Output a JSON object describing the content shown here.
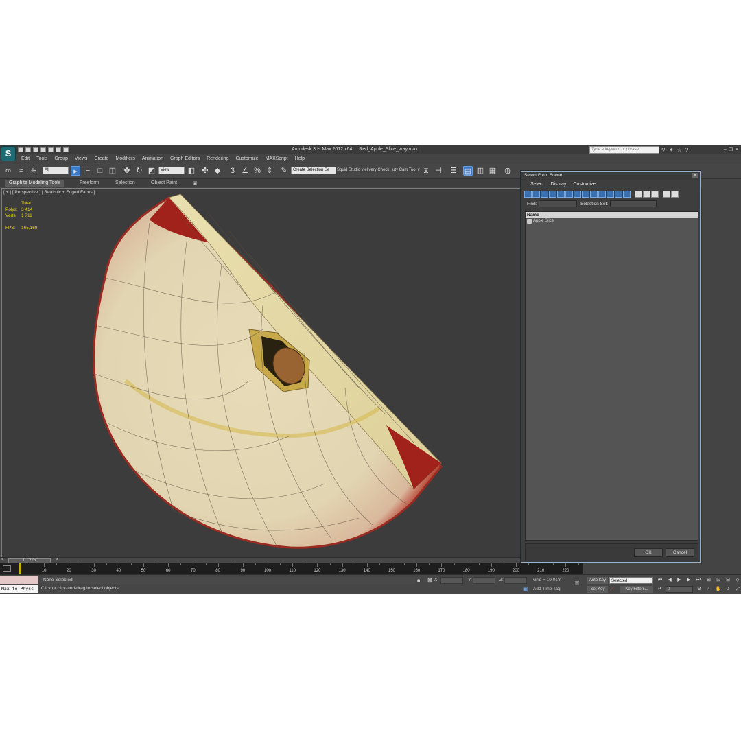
{
  "app": {
    "title_product": "Autodesk 3ds Max  2012 x64",
    "title_file": "Red_Apple_Slice_vray.max",
    "logo": "3ds-max-logo",
    "search_placeholder": "Type a keyword or phrase"
  },
  "menu": [
    "Edit",
    "Tools",
    "Group",
    "Views",
    "Create",
    "Modifiers",
    "Animation",
    "Graph Editors",
    "Rendering",
    "Customize",
    "MAXScript",
    "Help"
  ],
  "toolbar": {
    "selection_filter": "All",
    "reference_coord": "View",
    "named_selection": "Create Selection Se",
    "studio_label": "Squid Studio v elivery Check",
    "cam_tool_label": "uty Cam Tool v"
  },
  "ribbon": {
    "tabs": [
      "Graphite Modeling Tools",
      "Freeform",
      "Selection",
      "Object Paint"
    ]
  },
  "viewport": {
    "label": "[ + ] [ Perspective ] [ Realistic + Edged Faces ]",
    "stats": {
      "header": "Total",
      "polys_label": "Polys:",
      "polys_value": "3 414",
      "verts_label": "Verts:",
      "verts_value": "1 711",
      "fps_label": "FPS:",
      "fps_value": "165,169"
    }
  },
  "time_slider": {
    "value": "0 / 225",
    "prev": "<",
    "next": ">"
  },
  "trackbar": {
    "ticks": [
      "10",
      "20",
      "30",
      "40",
      "50",
      "60",
      "70",
      "80",
      "90",
      "100",
      "110",
      "120",
      "130",
      "140",
      "150",
      "160",
      "170",
      "180",
      "190",
      "200",
      "210",
      "220"
    ]
  },
  "status": {
    "maxscript": "Max to Physc",
    "selected": "None Selected",
    "prompt": "Click or click-and-drag to select objects",
    "x_label": "X:",
    "y_label": "Y:",
    "z_label": "Z:",
    "grid": "Grid = 10,0cm",
    "add_time_tag": "Add Time Tag",
    "auto_key": "Auto Key",
    "set_key": "Set Key",
    "key_mode": "Selected",
    "key_filters": "Key Filters...",
    "frame": "0"
  },
  "dialog": {
    "title": "Select From Scene",
    "menu": [
      "Select",
      "Display",
      "Customize"
    ],
    "find_label": "Find:",
    "selection_set_label": "Selection Set:",
    "list_header": "Name",
    "items": [
      "Apple Slice"
    ],
    "ok": "OK",
    "cancel": "Cancel"
  }
}
